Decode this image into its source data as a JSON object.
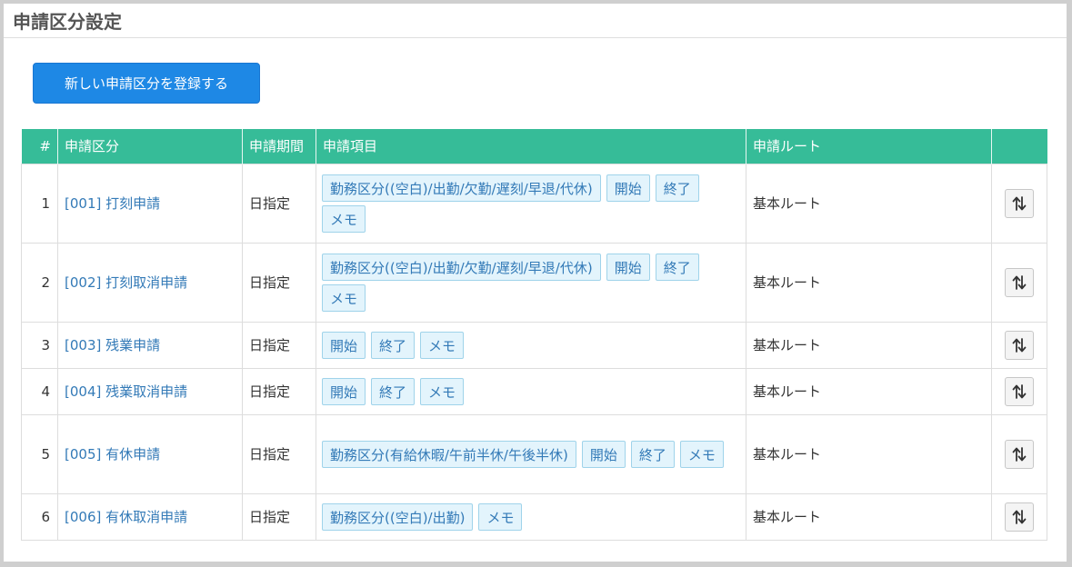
{
  "page": {
    "title": "申請区分設定"
  },
  "toolbar": {
    "register_label": "新しい申請区分を登録する"
  },
  "table": {
    "headers": [
      "#",
      "申請区分",
      "申請期間",
      "申請項目",
      "申請ルート",
      ""
    ],
    "rows": [
      {
        "num": "1",
        "name": "[001] 打刻申請",
        "period": "日指定",
        "items": [
          "勤務区分((空白)/出勤/欠勤/遅刻/早退/代休)",
          "開始",
          "終了",
          "メモ"
        ],
        "route": "基本ルート"
      },
      {
        "num": "2",
        "name": "[002] 打刻取消申請",
        "period": "日指定",
        "items": [
          "勤務区分((空白)/出勤/欠勤/遅刻/早退/代休)",
          "開始",
          "終了",
          "メモ"
        ],
        "route": "基本ルート"
      },
      {
        "num": "3",
        "name": "[003] 残業申請",
        "period": "日指定",
        "items": [
          "開始",
          "終了",
          "メモ"
        ],
        "route": "基本ルート"
      },
      {
        "num": "4",
        "name": "[004] 残業取消申請",
        "period": "日指定",
        "items": [
          "開始",
          "終了",
          "メモ"
        ],
        "route": "基本ルート"
      },
      {
        "num": "5",
        "name": "[005] 有休申請",
        "period": "日指定",
        "items": [
          "勤務区分(有給休暇/午前半休/午後半休)",
          "開始",
          "終了",
          "メモ"
        ],
        "route": "基本ルート"
      },
      {
        "num": "6",
        "name": "[006] 有休取消申請",
        "period": "日指定",
        "items": [
          "勤務区分((空白)/出勤)",
          "メモ"
        ],
        "route": "基本ルート"
      }
    ]
  },
  "icons": {
    "sort": "sort-up-down-icon"
  },
  "colors": {
    "header_bg": "#36bc98",
    "primary_button": "#1e88e5",
    "link": "#337ab7",
    "chip_bg": "#e3f4fc",
    "chip_border": "#9fd3ea"
  }
}
